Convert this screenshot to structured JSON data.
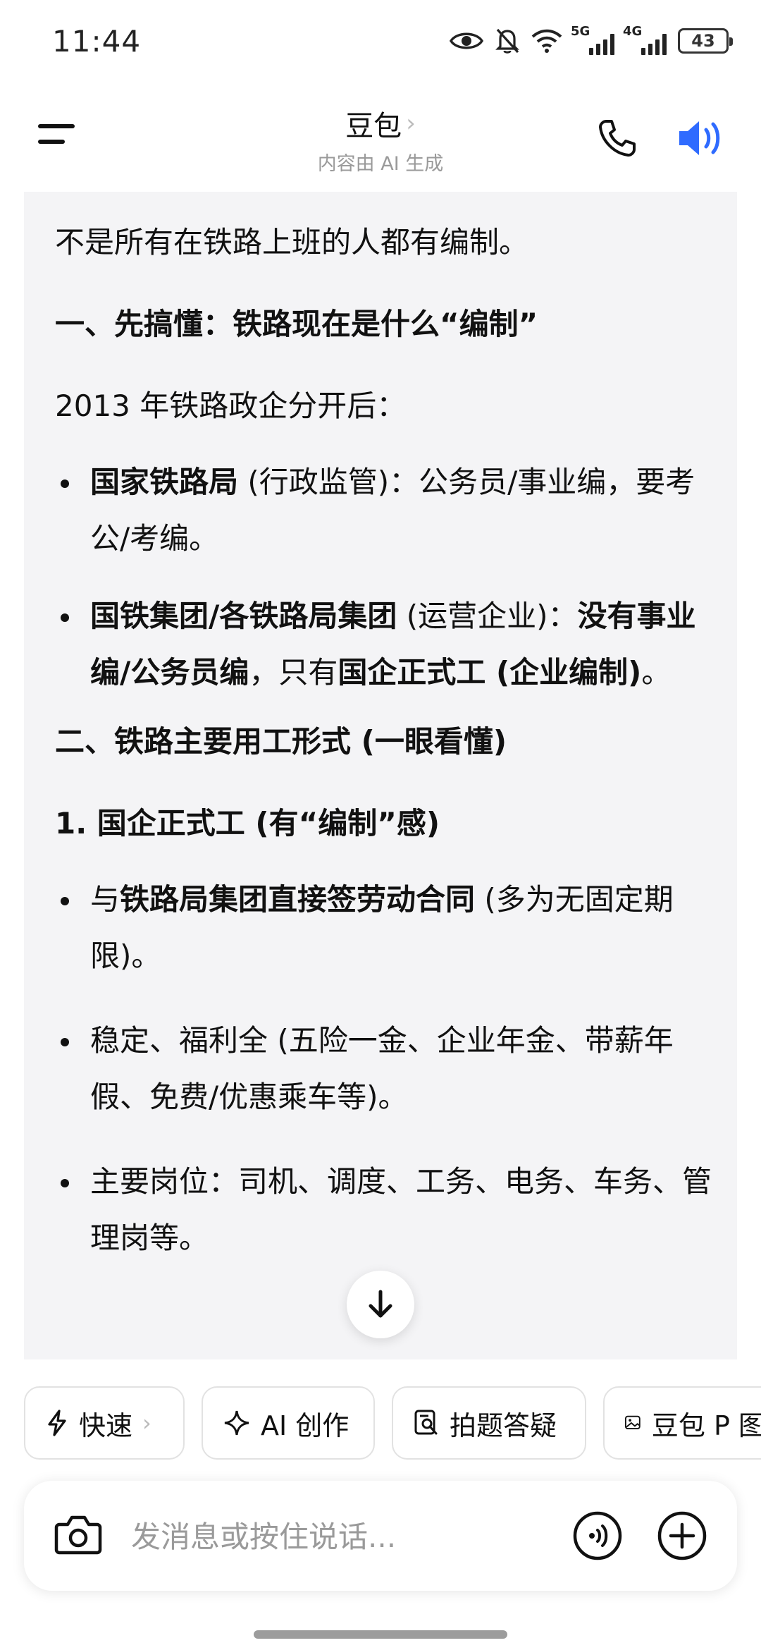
{
  "status_bar": {
    "time": "11:44",
    "net1": "5G",
    "net2": "4G",
    "battery": "43"
  },
  "header": {
    "title": "豆包",
    "title_chevron": "›",
    "subtitle": "内容由 AI 生成"
  },
  "message": {
    "intro": "不是所有在铁路上班的人都有编制。",
    "section1_title": "一、先搞懂：铁路现在是什么“编制”",
    "section1_lead": "2013 年铁路政企分开后：",
    "bullet1": {
      "strong": "国家铁路局",
      "rest": " (行政监管)：公务员/事业编，要考公/考编。"
    },
    "bullet2": {
      "strong1": "国铁集团/各铁路局集团",
      "mid": " (运营企业)：",
      "strong2": "没有事业编/公务员编",
      "mid2": "，只有",
      "strong3": "国企正式工 (企业编制)",
      "end": "。"
    },
    "section2_title": "二、铁路主要用工形式 (一眼看懂)",
    "sub1_title": "1. 国企正式工 (有“编制”感)",
    "bullet3": {
      "pre": "与",
      "strong": "铁路局集团直接签劳动合同",
      "rest": " (多为无固定期限)。"
    },
    "bullet4": "稳定、福利全 (五险一金、企业年金、带薪年假、免费/优惠乘车等)。",
    "bullet5": "主要岗位：司机、调度、工务、电务、车务、管理岗等。"
  },
  "chips": [
    {
      "label": "快速",
      "chevron": "›",
      "icon": "lightning-icon"
    },
    {
      "label": "AI 创作",
      "icon": "sparkle-icon"
    },
    {
      "label": "拍题答疑",
      "icon": "photo-question-icon"
    },
    {
      "label": "豆包 P 图",
      "icon": "image-edit-icon"
    }
  ],
  "input": {
    "placeholder": "发消息或按住说话..."
  },
  "colors": {
    "accent": "#2f6bff",
    "panel_bg": "#f4f4f6"
  }
}
